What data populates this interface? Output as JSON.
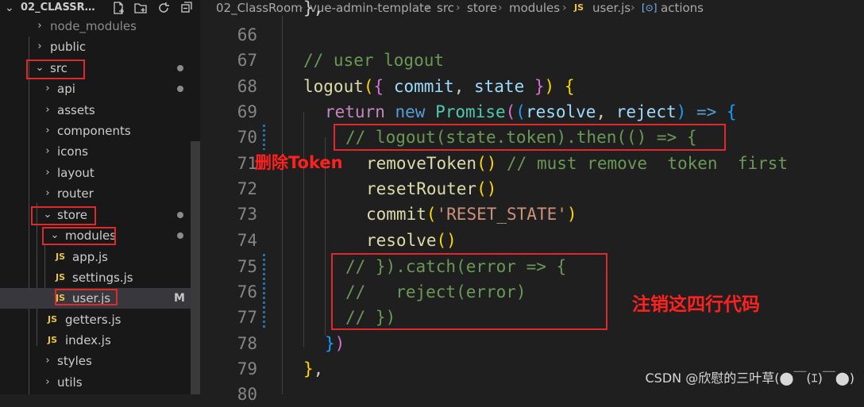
{
  "explorer": {
    "project_name": "02_CLASSROO...",
    "tree": [
      {
        "label": "node_modules",
        "kind": "folder",
        "expanded": false,
        "status": ""
      },
      {
        "label": "public",
        "kind": "folder",
        "expanded": false,
        "status": ""
      },
      {
        "label": "src",
        "kind": "folder",
        "expanded": true,
        "status": "dot"
      },
      {
        "label": "api",
        "kind": "folder",
        "expanded": false,
        "status": "dot"
      },
      {
        "label": "assets",
        "kind": "folder",
        "expanded": false,
        "status": ""
      },
      {
        "label": "components",
        "kind": "folder",
        "expanded": false,
        "status": ""
      },
      {
        "label": "icons",
        "kind": "folder",
        "expanded": false,
        "status": ""
      },
      {
        "label": "layout",
        "kind": "folder",
        "expanded": false,
        "status": ""
      },
      {
        "label": "router",
        "kind": "folder",
        "expanded": false,
        "status": ""
      },
      {
        "label": "store",
        "kind": "folder",
        "expanded": true,
        "status": "dot"
      },
      {
        "label": "modules",
        "kind": "folder",
        "expanded": true,
        "status": "dot"
      },
      {
        "label": "app.js",
        "kind": "js",
        "status": ""
      },
      {
        "label": "settings.js",
        "kind": "js",
        "status": ""
      },
      {
        "label": "user.js",
        "kind": "js",
        "status": "M",
        "selected": true
      },
      {
        "label": "getters.js",
        "kind": "js",
        "status": ""
      },
      {
        "label": "index.js",
        "kind": "js",
        "status": ""
      },
      {
        "label": "styles",
        "kind": "folder",
        "expanded": false,
        "status": ""
      },
      {
        "label": "utils",
        "kind": "folder",
        "expanded": false,
        "status": ""
      }
    ],
    "js_badge": "JS",
    "modified_badge": "M"
  },
  "breadcrumb": {
    "items": [
      "02_ClassRoom",
      "vue-admin-template",
      "src",
      "store",
      "modules",
      "user.js",
      "actions"
    ],
    "js_badge": "JS",
    "symbol_icon": "[⊙]"
  },
  "editor": {
    "line_numbers": [
      "66",
      "67",
      "68",
      "69",
      "70",
      "71",
      "72",
      "73",
      "74",
      "75",
      "76",
      "77",
      "78",
      "79",
      "80"
    ],
    "top_partial": "},"
  },
  "annotations": {
    "delete_token": "删除Token",
    "comment_four_lines": "注销这四行代码"
  },
  "watermark": "CSDN @欣慰的三叶草(⬤￣(ｴ)￣⬤)",
  "colors": {
    "annotation_red": "#e0292a",
    "keyword": "#569cd6",
    "comment": "#6a9955",
    "function": "#dcdcaa",
    "string": "#ce9178"
  }
}
